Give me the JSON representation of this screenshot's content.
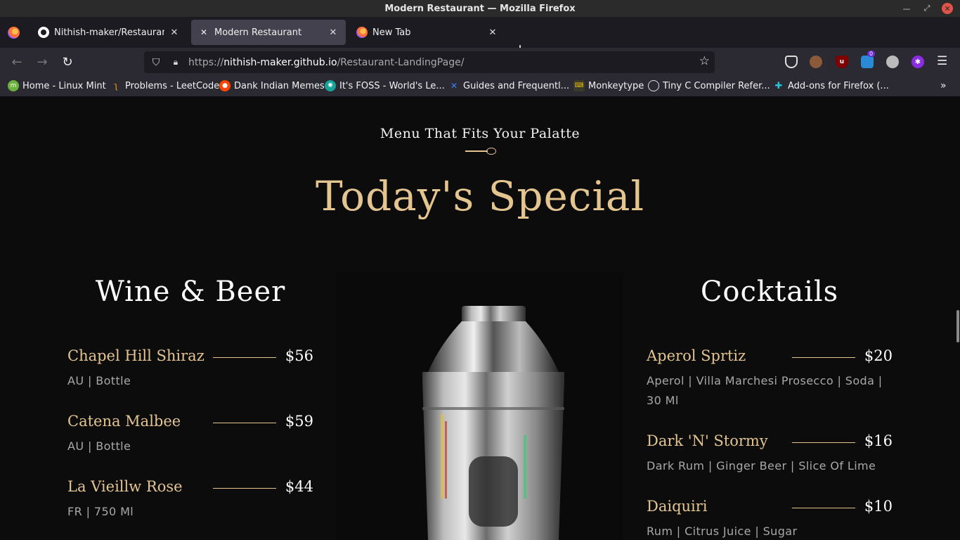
{
  "window": {
    "title": "Modern Restaurant — Mozilla Firefox"
  },
  "tabs": [
    {
      "label": "Nithish-maker/Restaurant-L",
      "icon": "github-icon"
    },
    {
      "label": "Modern Restaurant",
      "icon": "fork-knife-icon"
    },
    {
      "label": "New Tab",
      "icon": "firefox-icon"
    }
  ],
  "navbar": {
    "url_prefix": "https://",
    "url_host": "nithish-maker.github.io",
    "url_path": "/Restaurant-LandingPage/",
    "todo_badge": "0"
  },
  "bookmarks": [
    {
      "label": "Home - Linux Mint"
    },
    {
      "label": "Problems - LeetCode"
    },
    {
      "label": "Dank Indian Memes"
    },
    {
      "label": "It's FOSS - World's Le..."
    },
    {
      "label": "Guides and Frequentl..."
    },
    {
      "label": "Monkeytype"
    },
    {
      "label": "Tiny C Compiler Refer..."
    },
    {
      "label": "Add-ons for Firefox (..."
    }
  ],
  "page": {
    "subtitle": "Menu That Fits Your Palatte",
    "title": "Today's Special",
    "wine": {
      "heading": "Wine & Beer",
      "items": [
        {
          "name": "Chapel Hill Shiraz",
          "price": "$56",
          "desc": "AU | Bottle"
        },
        {
          "name": "Catena Malbee",
          "price": "$59",
          "desc": "AU | Bottle"
        },
        {
          "name": "La Vieillw Rose",
          "price": "$44",
          "desc": "FR | 750 Ml"
        }
      ]
    },
    "cocktails": {
      "heading": "Cocktails",
      "items": [
        {
          "name": "Aperol Sprtiz",
          "price": "$20",
          "desc": "Aperol | Villa Marchesi Prosecco | Soda | 30 Ml"
        },
        {
          "name": "Dark 'N' Stormy",
          "price": "$16",
          "desc": "Dark Rum | Ginger Beer | Slice Of Lime"
        },
        {
          "name": "Daiquiri",
          "price": "$10",
          "desc": "Rum | Citrus Juice | Sugar"
        }
      ]
    }
  },
  "colors": {
    "accent_gold": "#e4c590",
    "background": "#0c0c0c",
    "tab_active": "#42414d"
  }
}
